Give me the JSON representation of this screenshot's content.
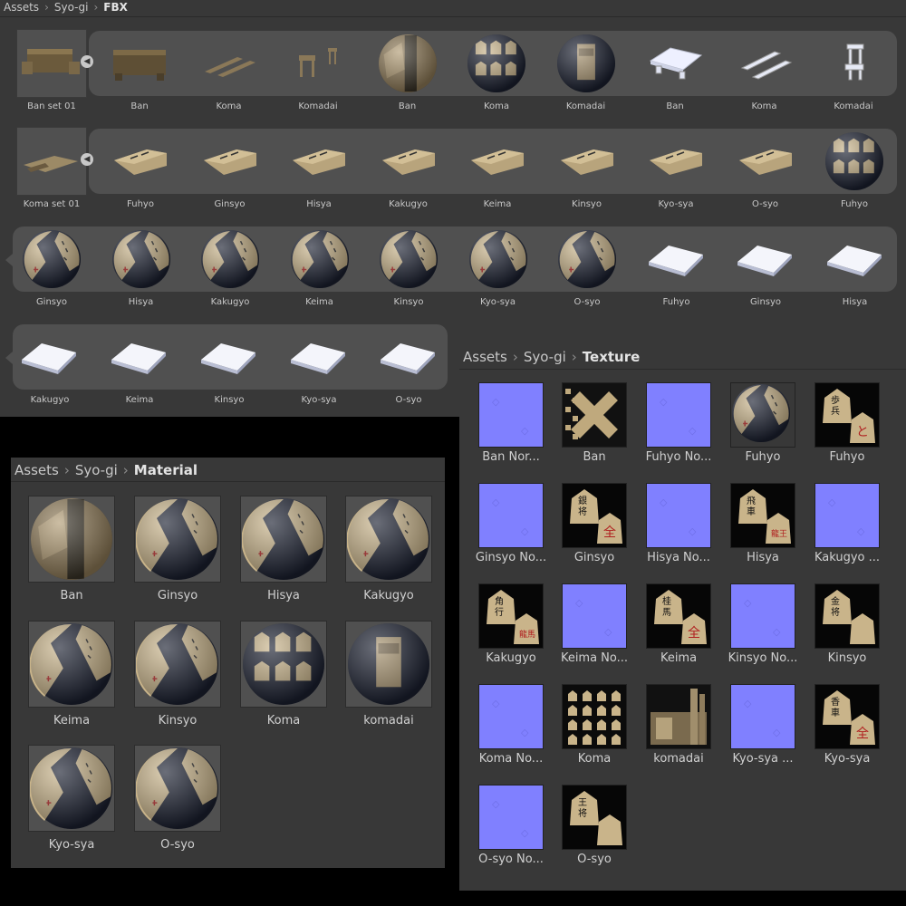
{
  "fbx": {
    "breadcrumb": [
      "Assets",
      "Syo-gi",
      "FBX"
    ],
    "row1": {
      "prefab": "Ban set 01",
      "items": [
        "Ban",
        "Koma",
        "Komadai",
        "Ban",
        "Koma",
        "Komadai",
        "Ban",
        "Koma",
        "Komadai"
      ],
      "kinds": [
        "board",
        "sticks",
        "stand",
        "ball-ban",
        "ball-koma",
        "ball-komadai",
        "wire-ban",
        "wire-koma",
        "wire-komadai"
      ]
    },
    "row2": {
      "prefab": "Koma set 01",
      "items": [
        "Fuhyo",
        "Ginsyo",
        "Hisya",
        "Kakugyo",
        "Keima",
        "Kinsyo",
        "Kyo-sya",
        "O-syo",
        "Fuhyo"
      ],
      "kinds": [
        "wedge",
        "wedge",
        "wedge",
        "wedge",
        "wedge",
        "wedge",
        "wedge",
        "wedge",
        "ball-koma"
      ]
    },
    "row3": {
      "items": [
        "Ginsyo",
        "Hisya",
        "Kakugyo",
        "Keima",
        "Kinsyo",
        "Kyo-sya",
        "O-syo",
        "Fuhyo",
        "Ginsyo",
        "Hisya"
      ],
      "kinds": [
        "ball",
        "ball",
        "ball",
        "ball",
        "ball",
        "ball",
        "ball",
        "white",
        "white",
        "white"
      ]
    },
    "row4": {
      "items": [
        "Kakugyo",
        "Keima",
        "Kinsyo",
        "Kyo-sya",
        "O-syo"
      ],
      "kinds": [
        "white",
        "white",
        "white",
        "white",
        "white"
      ]
    }
  },
  "texture": {
    "breadcrumb": [
      "Assets",
      "Syo-gi",
      "Texture"
    ],
    "items": [
      {
        "label": "Ban Nor...",
        "kind": "normal"
      },
      {
        "label": "Ban",
        "kind": "bantex"
      },
      {
        "label": "Fuhyo No...",
        "kind": "normal"
      },
      {
        "label": "Fuhyo",
        "kind": "ballthumb"
      },
      {
        "label": "Fuhyo",
        "kind": "piece",
        "top": "歩兵",
        "red": "と"
      },
      {
        "label": "Ginsyo No...",
        "kind": "normal"
      },
      {
        "label": "Ginsyo",
        "kind": "piece",
        "top": "銀将",
        "red": "全"
      },
      {
        "label": "Hisya No...",
        "kind": "normal"
      },
      {
        "label": "Hisya",
        "kind": "piece",
        "top": "飛車",
        "red": "龍王"
      },
      {
        "label": "Kakugyo ...",
        "kind": "normal"
      },
      {
        "label": "Kakugyo",
        "kind": "piece",
        "top": "角行",
        "red": "龍馬"
      },
      {
        "label": "Keima No...",
        "kind": "normal"
      },
      {
        "label": "Keima",
        "kind": "piece",
        "top": "桂馬",
        "red": "全"
      },
      {
        "label": "Kinsyo No...",
        "kind": "normal"
      },
      {
        "label": "Kinsyo",
        "kind": "piece",
        "top": "金将",
        "red": ""
      },
      {
        "label": "Koma No...",
        "kind": "normal"
      },
      {
        "label": "Koma",
        "kind": "komatex"
      },
      {
        "label": "komadai",
        "kind": "komadaitex"
      },
      {
        "label": "Kyo-sya ...",
        "kind": "normal"
      },
      {
        "label": "Kyo-sya",
        "kind": "piece",
        "top": "香車",
        "red": "全"
      },
      {
        "label": "O-syo No...",
        "kind": "normal"
      },
      {
        "label": "O-syo",
        "kind": "piece",
        "top": "王将",
        "red": ""
      }
    ]
  },
  "material": {
    "breadcrumb": [
      "Assets",
      "Syo-gi",
      "Material"
    ],
    "items": [
      {
        "label": "Ban",
        "kind": "ban"
      },
      {
        "label": "Ginsyo",
        "kind": "piece"
      },
      {
        "label": "Hisya",
        "kind": "piece"
      },
      {
        "label": "Kakugyo",
        "kind": "piece"
      },
      {
        "label": "Keima",
        "kind": "piece"
      },
      {
        "label": "Kinsyo",
        "kind": "piece"
      },
      {
        "label": "Koma",
        "kind": "koma"
      },
      {
        "label": "komadai",
        "kind": "komadai"
      },
      {
        "label": "Kyo-sya",
        "kind": "piece"
      },
      {
        "label": "O-syo",
        "kind": "piece"
      }
    ]
  },
  "colors": {
    "panel": "#383838",
    "pill": "#505050",
    "normal_map": "#8080ff",
    "wood": "#c9b48a",
    "navy": "#1b2030",
    "red_kanji": "#b02020"
  }
}
